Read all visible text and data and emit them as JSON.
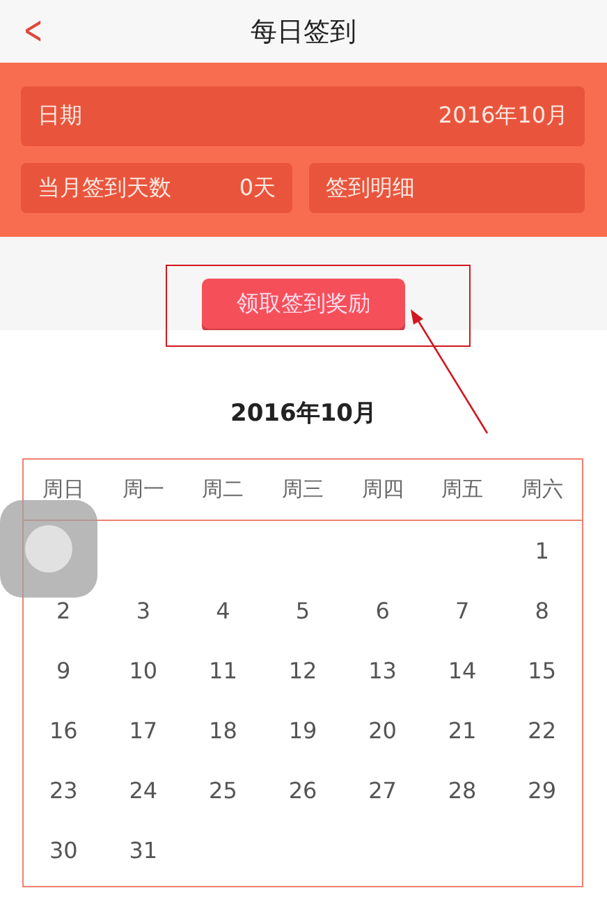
{
  "header": {
    "back_icon": "<",
    "title": "每日签到"
  },
  "summary": {
    "date_label": "日期",
    "date_value": "2016年10月",
    "days_label": "当月签到天数",
    "days_value": "0天",
    "detail_label": "签到明细"
  },
  "claim_button": "领取签到奖励",
  "calendar": {
    "title": "2016年10月",
    "weekdays": [
      "周日",
      "周一",
      "周二",
      "周三",
      "周四",
      "周五",
      "周六"
    ],
    "weeks": [
      {
        "kind": "partial",
        "days": [
          "1"
        ]
      },
      {
        "kind": "full",
        "days": [
          "2",
          "3",
          "4",
          "5",
          "6",
          "7",
          "8"
        ]
      },
      {
        "kind": "full",
        "days": [
          "9",
          "10",
          "11",
          "12",
          "13",
          "14",
          "15"
        ]
      },
      {
        "kind": "full",
        "days": [
          "16",
          "17",
          "18",
          "19",
          "20",
          "21",
          "22"
        ]
      },
      {
        "kind": "full",
        "days": [
          "23",
          "24",
          "25",
          "26",
          "27",
          "28",
          "29"
        ]
      },
      {
        "kind": "full",
        "days": [
          "30",
          "31"
        ]
      }
    ]
  }
}
